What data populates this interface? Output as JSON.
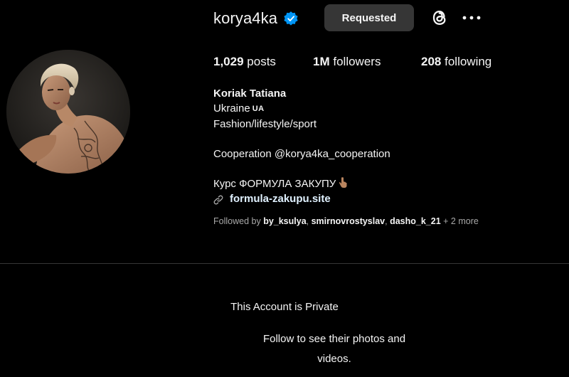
{
  "header": {
    "username": "korya4ka",
    "requested_label": "Requested",
    "icons": {
      "verified": "verified-badge-icon",
      "threads": "threads-icon",
      "more": "more-options-icon"
    }
  },
  "stats": {
    "posts_count": "1,029",
    "posts_label": "posts",
    "followers_count": "1M",
    "followers_label": "followers",
    "following_count": "208",
    "following_label": "following"
  },
  "bio": {
    "name": "Koriak Tatiana",
    "line1": "Ukraine",
    "flag": "UA",
    "line2": "Fashion/lifestyle/sport",
    "line3": "Cooperation @korya4ka_cooperation",
    "line4": "Курс ФОРМУЛА ЗАКУПУ",
    "link": "formula-zakupu.site"
  },
  "followed_by": {
    "prefix": "Followed by",
    "user1": "by_ksulya",
    "sep1": ", ",
    "user2": "smirnovrostyslav",
    "sep2": ", ",
    "user3": "dasho_k_21",
    "suffix": " + 2 more"
  },
  "private": {
    "title": "This Account is Private",
    "subtitle": "Follow to see their photos and videos."
  },
  "colors": {
    "background": "#000000",
    "button_bg": "#363636",
    "verified": "#0095f6",
    "link": "#e0f1ff",
    "muted": "#a8a8a8"
  }
}
